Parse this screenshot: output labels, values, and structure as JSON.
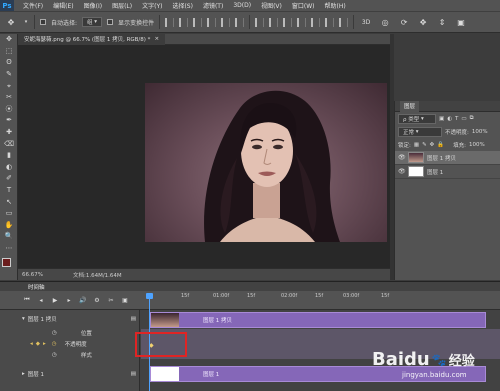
{
  "app": {
    "logo": "Ps"
  },
  "menu": [
    "文件(F)",
    "编辑(E)",
    "图像(I)",
    "图层(L)",
    "文字(Y)",
    "选择(S)",
    "滤镜(T)",
    "3D(D)",
    "视图(V)",
    "窗口(W)",
    "帮助(H)"
  ],
  "options": {
    "auto_select_label": "自动选择:",
    "auto_select_value": "组",
    "show_transform_label": "显示变换控件"
  },
  "document": {
    "tab_title": "安妮海瑟薇.png @ 66.7% (图层 1 拷贝, RGB/8) *",
    "close_glyph": "×",
    "zoom": "66.67%",
    "doc_size": "文档:1.64M/1.64M"
  },
  "tools": [
    "✥",
    "⬚",
    "ʘ",
    "✎",
    "⌖",
    "✂",
    "⦿",
    "✒",
    "✚",
    "⌫",
    "▮",
    "◐",
    "✐",
    "T",
    "↖",
    "▭",
    "✋",
    "🔍",
    "⋯"
  ],
  "layers_panel": {
    "title": "图层",
    "filter_label": "ρ 类型",
    "blend_mode": "正常",
    "opacity_label": "不透明度:",
    "opacity_value": "100%",
    "lock_label": "锁定:",
    "fill_label": "填充:",
    "fill_value": "100%",
    "layers": [
      {
        "name": "图层 1 拷贝",
        "selected": true
      },
      {
        "name": "图层 1",
        "selected": false
      }
    ]
  },
  "timeline": {
    "title": "时间轴",
    "ruler": [
      "15f",
      "01:00f",
      "15f",
      "02:00f",
      "15f",
      "03:00f",
      "15f"
    ],
    "tracks": [
      {
        "name": "图层 1 拷贝",
        "clip_label": "图层 1 拷贝"
      },
      {
        "name": "图层 1",
        "clip_label": "图层 1"
      }
    ],
    "properties": [
      "位置",
      "不透明度",
      "样式"
    ]
  },
  "watermark": {
    "brand": "Baidu",
    "suffix": "经验",
    "url": "jingyan.baidu.com"
  },
  "colors": {
    "clip": "#8567b8",
    "highlight": "#e02424",
    "playhead": "#4ea3ff"
  }
}
